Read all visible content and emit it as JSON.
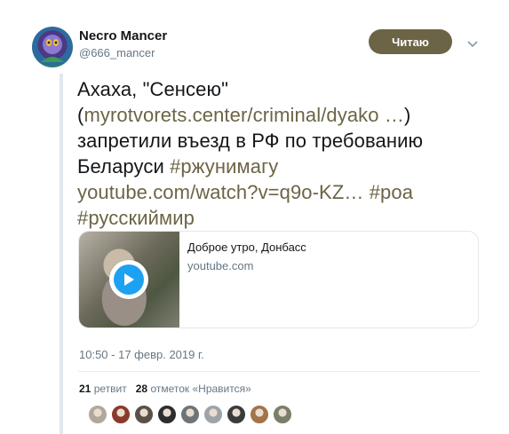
{
  "user": {
    "display_name": "Necro Mancer",
    "handle": "@666_mancer"
  },
  "follow_button": {
    "label": "Читаю"
  },
  "tweet": {
    "lines": [
      [
        {
          "text": "Ахаха, \"Сенсею\"",
          "link": false
        }
      ],
      [
        {
          "text": "(",
          "link": false
        },
        {
          "text": "myrotvorets.center/criminal/dyako …",
          "link": true
        },
        {
          "text": ")",
          "link": false
        }
      ],
      [
        {
          "text": "запретили въезд в РФ по требованию",
          "link": false
        }
      ],
      [
        {
          "text": "Беларуси ",
          "link": false
        },
        {
          "text": "#ржунимагу",
          "link": true
        }
      ],
      [
        {
          "text": "youtube.com/watch?v=q9o-KZ…",
          "link": true
        },
        {
          "text": " ",
          "link": false
        },
        {
          "text": "#роа",
          "link": true
        }
      ],
      [
        {
          "text": "#русскиймир",
          "link": true
        }
      ]
    ]
  },
  "card": {
    "title": "Доброе утро, Донбасс",
    "domain": "youtube.com"
  },
  "timestamp": "10:50 - 17 февр. 2019 г.",
  "stats": {
    "retweets_count": "21",
    "retweets_label": "ретвит",
    "likes_count": "28",
    "likes_label": "отметок «Нравится»"
  },
  "colors": {
    "accent": "#6c6446",
    "muted": "#657786",
    "play": "#1da1f2"
  },
  "likers": [
    {
      "color": "#b0a89a"
    },
    {
      "color": "#8a3a2a"
    },
    {
      "color": "#5a5048"
    },
    {
      "color": "#2d2d2d"
    },
    {
      "color": "#6f7478"
    },
    {
      "color": "#9ea3a8"
    },
    {
      "color": "#3b3b3b"
    },
    {
      "color": "#a27448"
    },
    {
      "color": "#7a7e6a"
    }
  ]
}
